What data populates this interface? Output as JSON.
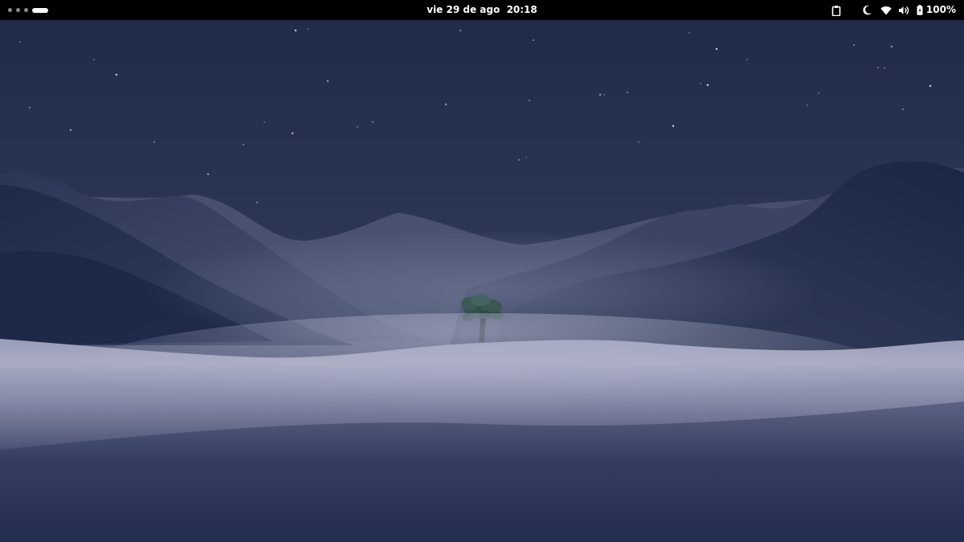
{
  "topbar": {
    "activities": {
      "icon": "workspace-indicator-icon",
      "workspaces": 4,
      "active_index": 3
    },
    "clock": {
      "date": "vie 29 de ago",
      "time": "20:18"
    },
    "tray": {
      "icons": [
        "clipboard-icon",
        "night-light-icon",
        "wifi-icon",
        "volume-icon",
        "battery-icon"
      ],
      "battery_level": "100%"
    }
  },
  "wallpaper": {
    "scene": "tree-on-dunes-night",
    "colors": {
      "sky_top": "#1f2a48",
      "sky_horizon": "#56607e",
      "dune_light": "#a6a9c3",
      "dune_dark": "#1e2a4c",
      "tree": "#2f4a48"
    }
  }
}
